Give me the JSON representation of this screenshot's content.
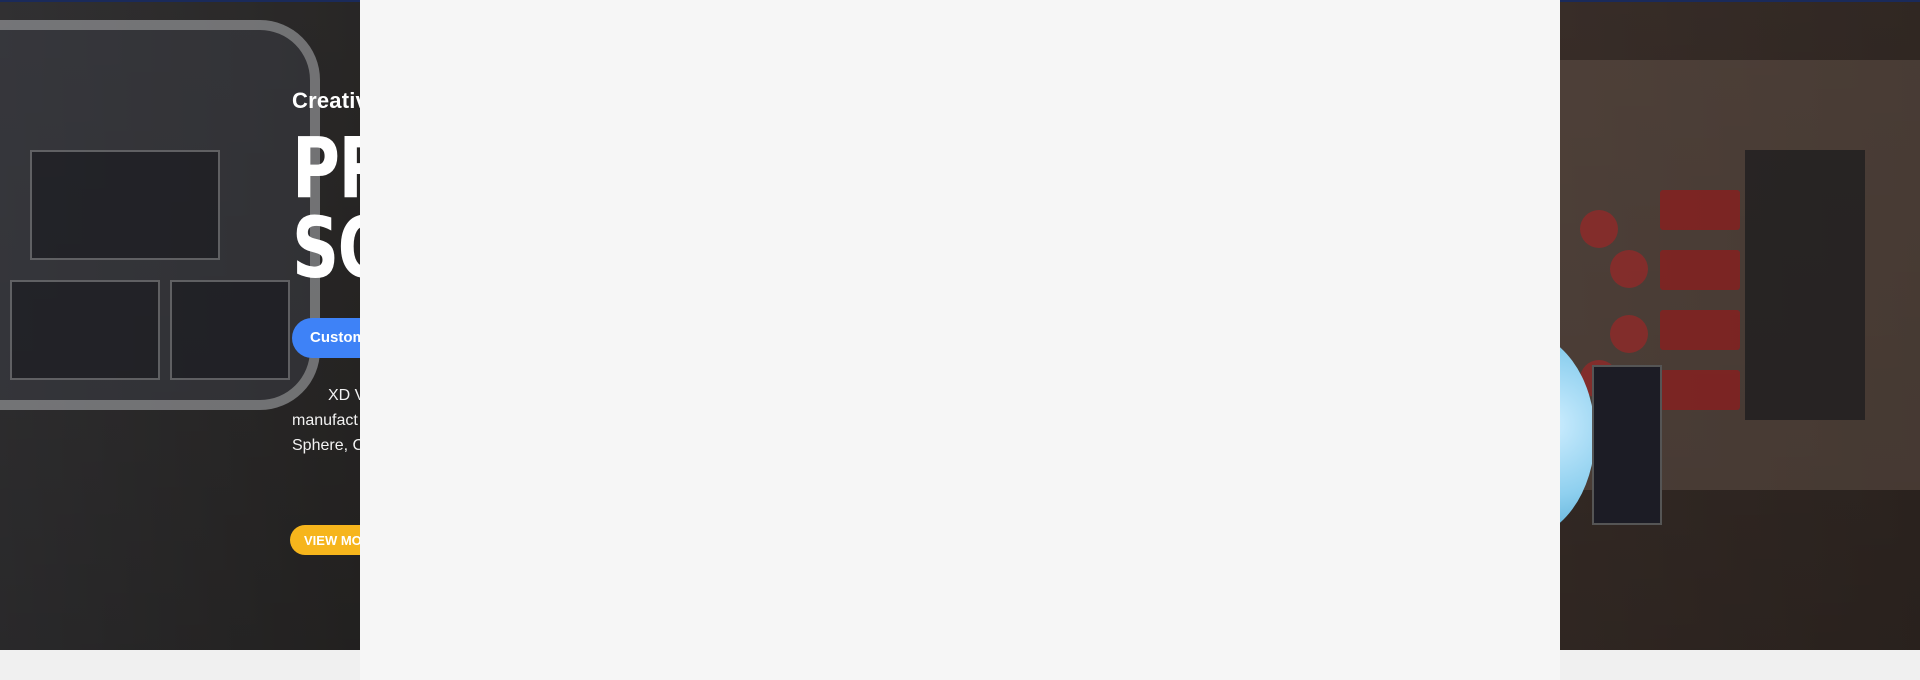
{
  "hero": {
    "subtitle": "Creativ",
    "headline_line1": "PR",
    "headline_line2": "SO",
    "pill_label": "Custom",
    "desc_line1": "XD V",
    "desc_line2": "manufact",
    "desc_line3": "Sphere, Cy",
    "view_more_label": "VIEW MO"
  },
  "colors": {
    "pill_blue": "#3e82f7",
    "button_yellow": "#f6b51c",
    "overlay": "#f6f6f6"
  }
}
